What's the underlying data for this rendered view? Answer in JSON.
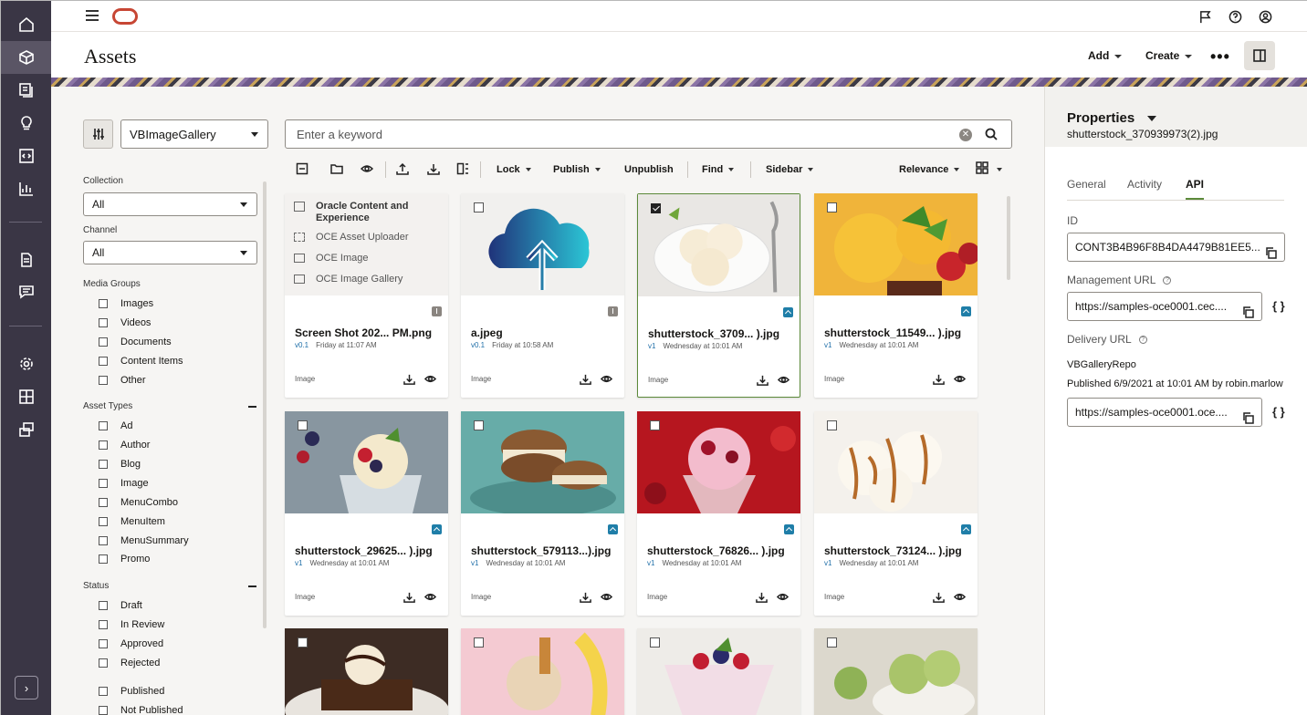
{
  "page": {
    "title": "Assets"
  },
  "header": {
    "add_label": "Add",
    "create_label": "Create",
    "more_label": "•••"
  },
  "filters": {
    "repository": "VBImageGallery",
    "collection_label": "Collection",
    "collection_value": "All",
    "channel_label": "Channel",
    "channel_value": "All",
    "media_groups_label": "Media Groups",
    "media_groups": [
      "Images",
      "Videos",
      "Documents",
      "Content Items",
      "Other"
    ],
    "asset_types_label": "Asset Types",
    "asset_types": [
      "Ad",
      "Author",
      "Blog",
      "Image",
      "MenuCombo",
      "MenuItem",
      "MenuSummary",
      "Promo"
    ],
    "status_label": "Status",
    "status": [
      "Draft",
      "In Review",
      "Approved",
      "Rejected"
    ],
    "publish_status": [
      "Published",
      "Not Published"
    ]
  },
  "search": {
    "placeholder": "Enter a keyword"
  },
  "toolbar": {
    "lock": "Lock",
    "publish": "Publish",
    "unpublish": "Unpublish",
    "find": "Find",
    "sidebar": "Sidebar",
    "sort": "Relevance"
  },
  "assets": [
    {
      "name": "Screen Shot 202... PM.png",
      "version": "v0.1",
      "date": "Friday at 11:07 AM",
      "kind": "Image",
      "thumb_lines": [
        "Oracle Content and",
        "Experience",
        "OCE Asset Uploader",
        "OCE Image",
        "OCE Image Gallery"
      ]
    },
    {
      "name": "a.jpeg",
      "version": "v0.1",
      "date": "Friday at 10:58 AM",
      "kind": "Image"
    },
    {
      "name": "shutterstock_3709... ).jpg",
      "version": "v1",
      "date": "Wednesday at 10:01 AM",
      "kind": "Image"
    },
    {
      "name": "shutterstock_11549... ).jpg",
      "version": "v1",
      "date": "Wednesday at 10:01 AM",
      "kind": "Image"
    },
    {
      "name": "shutterstock_29625... ).jpg",
      "version": "v1",
      "date": "Wednesday at 10:01 AM",
      "kind": "Image"
    },
    {
      "name": "shutterstock_579113...).jpg",
      "version": "v1",
      "date": "Wednesday at 10:01 AM",
      "kind": "Image"
    },
    {
      "name": "shutterstock_76826... ).jpg",
      "version": "v1",
      "date": "Wednesday at 10:01 AM",
      "kind": "Image"
    },
    {
      "name": "shutterstock_73124... ).jpg",
      "version": "v1",
      "date": "Wednesday at 10:01 AM",
      "kind": "Image"
    }
  ],
  "properties": {
    "title": "Properties",
    "file": "shutterstock_370939973(2).jpg",
    "tabs": [
      "General",
      "Activity",
      "API"
    ],
    "id_label": "ID",
    "id_value": "CONT3B4B96F8B4DA4479B81EE5...",
    "management_label": "Management URL",
    "management_value": "https://samples-oce0001.cec....",
    "delivery_label": "Delivery URL",
    "repo_name": "VBGalleryRepo",
    "published_info": "Published 6/9/2021 at 10:01 AM by robin.marlow",
    "delivery_value": "https://samples-oce0001.oce....",
    "braces": "{ }"
  }
}
